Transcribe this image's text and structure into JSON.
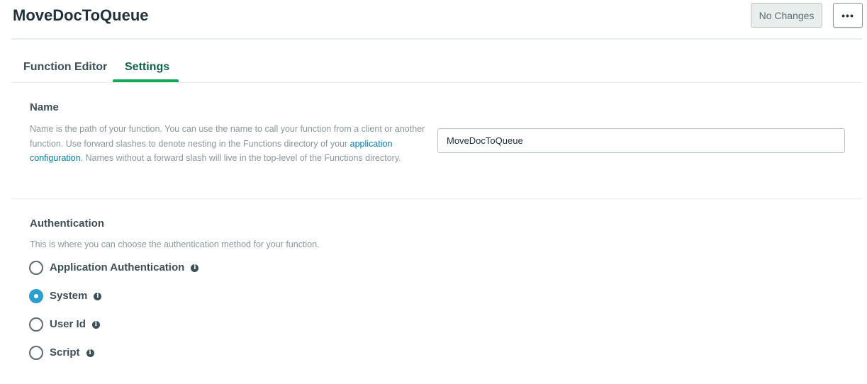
{
  "header": {
    "title": "MoveDocToQueue",
    "save_button_label": "No Changes",
    "more_button_label": "•••"
  },
  "tabs": [
    {
      "label": "Function Editor",
      "active": false
    },
    {
      "label": "Settings",
      "active": true
    }
  ],
  "name_section": {
    "title": "Name",
    "description_part1": "Name is the path of your function. You can use the name to call your function from a client or another function. Use forward slashes to denote nesting in the Functions directory of your ",
    "description_link": "application configuration",
    "description_part2": ". Names without a forward slash will live in the top-level of the Functions directory.",
    "input_value": "MoveDocToQueue"
  },
  "auth_section": {
    "title": "Authentication",
    "description": "This is where you can choose the authentication method for your function.",
    "options": [
      {
        "label": "Application Authentication",
        "selected": false
      },
      {
        "label": "System",
        "selected": true
      },
      {
        "label": "User Id",
        "selected": false
      },
      {
        "label": "Script",
        "selected": false
      }
    ]
  },
  "icons": {
    "info": "info-icon",
    "more": "ellipsis-icon"
  },
  "colors": {
    "accent_green": "#13aa52",
    "active_tab_text": "#116149",
    "radio_selected": "#2a9fd0",
    "link": "#007cad"
  }
}
